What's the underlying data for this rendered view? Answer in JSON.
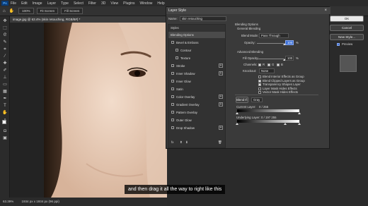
{
  "app": {
    "logo": "Ps",
    "menu": [
      "File",
      "Edit",
      "Image",
      "Layer",
      "Type",
      "Select",
      "Filter",
      "3D",
      "View",
      "Plugins",
      "Window",
      "Help"
    ],
    "options": {
      "zoom": "100%",
      "fit_screen": "Fit Screen",
      "fill_screen": "Fill Screen"
    }
  },
  "document": {
    "tab": "image.jpg @ 63.4% (skin retouching, RGB/8#) *",
    "status_zoom": "63.39%",
    "status_info": "1934 px x 1934 px (96 ppi)"
  },
  "dialog": {
    "title": "Layer Style",
    "name_label": "Name:",
    "name_value": "skin retouching",
    "styles_header": "Styles",
    "styles": [
      {
        "label": "Blending Options",
        "checkbox": false,
        "plus": false,
        "selected": true
      },
      {
        "label": "Bevel & Emboss",
        "checkbox": true,
        "plus": false,
        "selected": false
      },
      {
        "label": "Contour",
        "checkbox": true,
        "plus": false,
        "selected": false,
        "indent": true
      },
      {
        "label": "Texture",
        "checkbox": true,
        "plus": false,
        "selected": false,
        "indent": true
      },
      {
        "label": "Stroke",
        "checkbox": true,
        "plus": true,
        "selected": false
      },
      {
        "label": "Inner Shadow",
        "checkbox": true,
        "plus": true,
        "selected": false
      },
      {
        "label": "Inner Glow",
        "checkbox": true,
        "plus": false,
        "selected": false
      },
      {
        "label": "Satin",
        "checkbox": true,
        "plus": false,
        "selected": false
      },
      {
        "label": "Color Overlay",
        "checkbox": true,
        "plus": true,
        "selected": false
      },
      {
        "label": "Gradient Overlay",
        "checkbox": true,
        "plus": true,
        "selected": false
      },
      {
        "label": "Pattern Overlay",
        "checkbox": true,
        "plus": false,
        "selected": false
      },
      {
        "label": "Outer Glow",
        "checkbox": true,
        "plus": false,
        "selected": false
      },
      {
        "label": "Drop Shadow",
        "checkbox": true,
        "plus": true,
        "selected": false
      }
    ],
    "footer_icons": [
      "fx",
      "up-arrow",
      "down-arrow",
      "trash"
    ],
    "blending": {
      "header": "Blending Options",
      "general_header": "General Blending",
      "blend_mode_label": "Blend Mode:",
      "blend_mode_value": "Pass Through",
      "opacity_label": "Opacity:",
      "opacity_value": "100",
      "percent": "%",
      "advanced_header": "Advanced Blending",
      "fill_opacity_label": "Fill Opacity:",
      "fill_opacity_value": "100",
      "channels_label": "Channels:",
      "channels": [
        "R",
        "G",
        "B"
      ],
      "knockout_label": "Knockout:",
      "knockout_value": "None",
      "options": [
        {
          "label": "Blend Interior Effects as Group",
          "checked": false
        },
        {
          "label": "Blend Clipped Layers as Group",
          "checked": true
        },
        {
          "label": "Transparency Shapes Layer",
          "checked": true
        },
        {
          "label": "Layer Mask Hides Effects",
          "checked": false
        },
        {
          "label": "Vector Mask Hides Effects",
          "checked": false
        }
      ],
      "blend_if_label": "Blend If:",
      "blend_if_value": "Gray",
      "current_layer_label": "Current Layer:",
      "current_layer_values": "0   /   255",
      "underlying_layer_label": "Underlying Layer:",
      "underlying_layer_values": "0   /   197   255"
    },
    "buttons": {
      "ok": "OK",
      "cancel": "Cancel",
      "new_style": "New Style...",
      "preview": "Preview"
    }
  },
  "subtitle": "and then drag it all the way to right like this"
}
